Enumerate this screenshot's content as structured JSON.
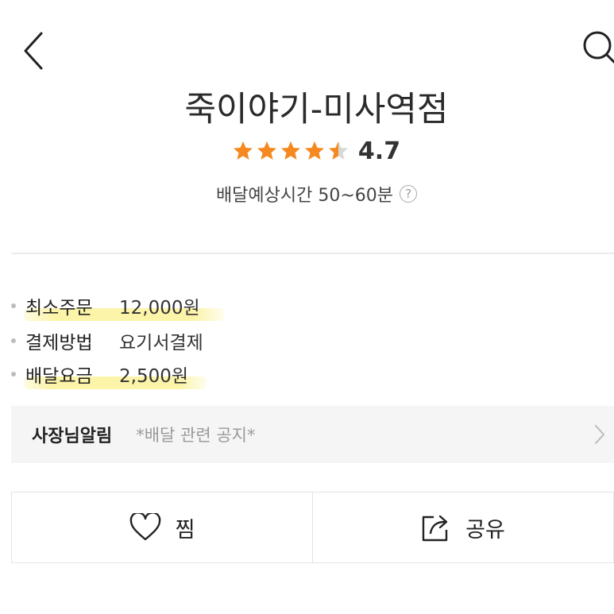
{
  "store": {
    "name": "죽이야기-미사역점",
    "rating": "4.7",
    "rating_stars": 4.5,
    "delivery_time": "배달예상시간 50~60분",
    "help_glyph": "?"
  },
  "info": [
    {
      "label": "최소주문",
      "value": "12,000원",
      "highlighted": true
    },
    {
      "label": "결제방법",
      "value": "요기서결제",
      "highlighted": false
    },
    {
      "label": "배달요금",
      "value": "2,500원",
      "highlighted": true
    }
  ],
  "notice": {
    "title": "사장님알림",
    "text": "*배달 관련 공지*"
  },
  "actions": {
    "favorite_label": "찜",
    "share_label": "공유"
  },
  "colors": {
    "star": "#f5891f",
    "star_empty": "#d8d8d8",
    "highlight": "#faf08c"
  },
  "icons": [
    "back-arrow-icon",
    "search-icon",
    "star-icon",
    "help-icon",
    "chevron-right-icon",
    "heart-icon",
    "share-icon"
  ]
}
